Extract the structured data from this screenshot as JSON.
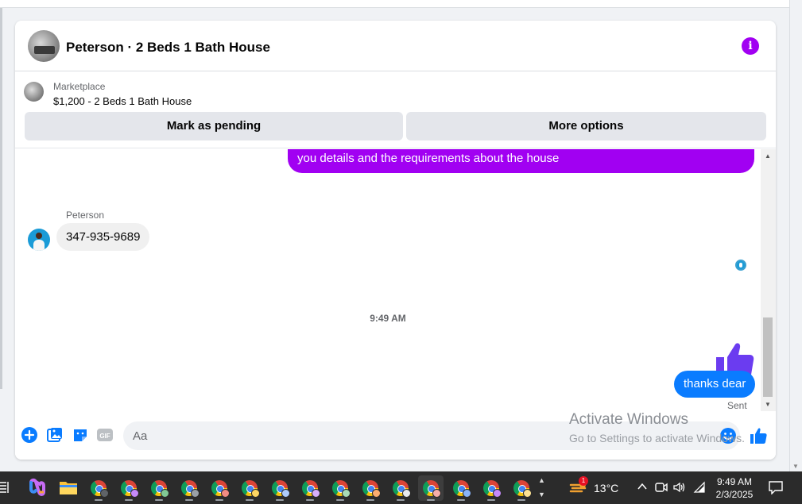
{
  "conversation": {
    "title": "Peterson · 2 Beds 1 Bath House",
    "info_icon": "info-icon"
  },
  "marketplace": {
    "label": "Marketplace",
    "listing": "$1,200 - 2 Beds 1 Bath House",
    "pending_button": "Mark as pending",
    "more_button": "More options"
  },
  "messages": {
    "outgoing_partial": "you details and the requirements about the house",
    "sender_name": "Peterson",
    "incoming_text": "347-935-9689",
    "timestamp": "9:49 AM",
    "sticker": "thumbs-up-icon",
    "outgoing_text": "thanks dear",
    "status": "Sent"
  },
  "composer": {
    "placeholder": "Aa"
  },
  "watermark": {
    "line1": "Activate Windows",
    "line2": "Go to Settings to activate Windows."
  },
  "taskbar": {
    "weather_badge": "1",
    "temperature": "13°C",
    "time": "9:49 AM",
    "date": "2/3/2025",
    "apps": [
      {
        "name": "taskbar-app-1",
        "badge": "#5f6368",
        "active": false
      },
      {
        "name": "taskbar-app-2",
        "badge": "#c58af9",
        "active": false
      },
      {
        "name": "taskbar-app-3",
        "badge": "#81c995",
        "active": false
      },
      {
        "name": "taskbar-app-4",
        "badge": "#9aa0a6",
        "active": false
      },
      {
        "name": "taskbar-app-5",
        "badge": "#f28b82",
        "active": false
      },
      {
        "name": "taskbar-app-6",
        "badge": "#fdd663",
        "active": false
      },
      {
        "name": "taskbar-app-7",
        "badge": "#aecbfa",
        "active": false
      },
      {
        "name": "taskbar-app-8",
        "badge": "#d7aefb",
        "active": false
      },
      {
        "name": "taskbar-app-9",
        "badge": "#a8dab5",
        "active": false
      },
      {
        "name": "taskbar-app-10",
        "badge": "#fcad70",
        "active": false
      },
      {
        "name": "taskbar-app-11",
        "badge": "#e8eaed",
        "active": false
      },
      {
        "name": "taskbar-app-12",
        "badge": "#f6aea9",
        "active": true
      },
      {
        "name": "taskbar-app-13",
        "badge": "#8ab4f8",
        "active": false
      },
      {
        "name": "taskbar-app-14",
        "badge": "#c58af9",
        "active": false
      },
      {
        "name": "taskbar-app-15",
        "badge": "#fde293",
        "active": false
      }
    ]
  },
  "colors": {
    "accent_purple": "#a100f2",
    "messenger_blue": "#0a7cff",
    "sticker_purple": "#6b3cf0"
  }
}
